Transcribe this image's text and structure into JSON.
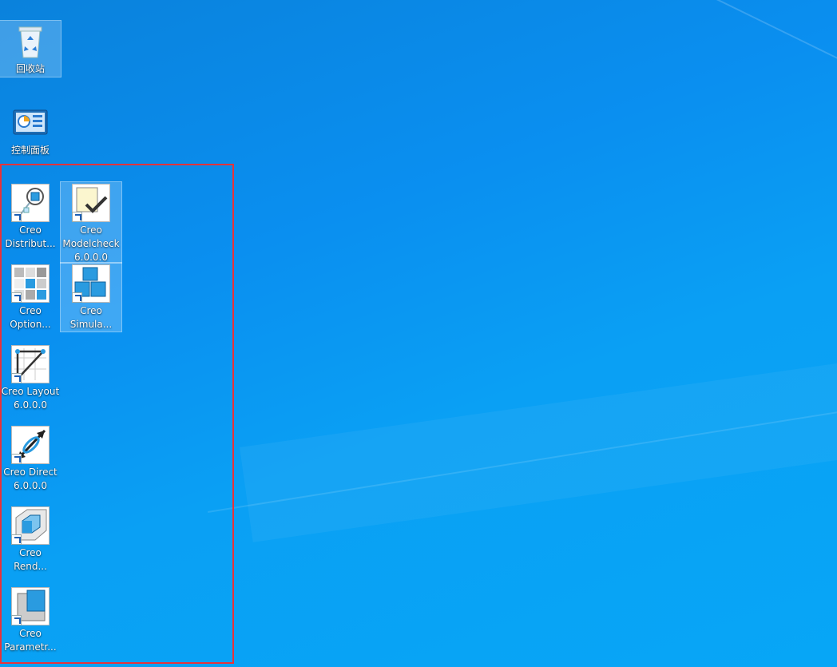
{
  "desktop": {
    "icons": [
      {
        "id": "recycle-bin",
        "lines": [
          "回收站"
        ]
      },
      {
        "id": "control-panel",
        "lines": [
          "控制面板"
        ]
      },
      {
        "id": "creo-distributed",
        "lines": [
          "Creo",
          "Distribut..."
        ]
      },
      {
        "id": "creo-modelcheck",
        "lines": [
          "Creo",
          "Modelcheck",
          "6.0.0.0"
        ]
      },
      {
        "id": "creo-options",
        "lines": [
          "Creo",
          "Option..."
        ]
      },
      {
        "id": "creo-simulate",
        "lines": [
          "Creo",
          "Simula..."
        ]
      },
      {
        "id": "creo-layout",
        "lines": [
          "Creo Layout",
          "6.0.0.0"
        ]
      },
      {
        "id": "creo-direct",
        "lines": [
          "Creo Direct",
          "6.0.0.0"
        ]
      },
      {
        "id": "creo-render",
        "lines": [
          "Creo",
          "Rend..."
        ]
      },
      {
        "id": "creo-parametric",
        "lines": [
          "Creo",
          "Parametr..."
        ]
      }
    ]
  },
  "colors": {
    "highlight_box": "#e8333a",
    "desktop_blue": "#0a9af0"
  }
}
